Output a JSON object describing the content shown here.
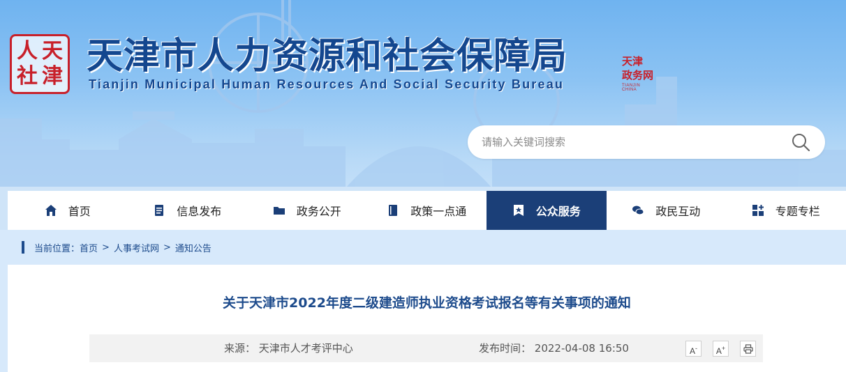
{
  "header": {
    "logo_text": [
      "人",
      "天",
      "社",
      "津"
    ],
    "title": "天津市人力资源和社会保障局",
    "subtitle": "Tianjin Municipal Human Resources And Social Security Bureau",
    "stamp_text": "天津 政务网",
    "stamp_sub": "TIANJIN CHINA"
  },
  "search": {
    "placeholder": "请输入关键词搜索"
  },
  "nav": {
    "items": [
      {
        "label": "首页",
        "icon": "home-icon",
        "active": false
      },
      {
        "label": "信息发布",
        "icon": "document-icon",
        "active": false
      },
      {
        "label": "政务公开",
        "icon": "folder-icon",
        "active": false
      },
      {
        "label": "政策一点通",
        "icon": "book-icon",
        "active": false
      },
      {
        "label": "公众服务",
        "icon": "star-badge-icon",
        "active": true
      },
      {
        "label": "政民互动",
        "icon": "chat-icon",
        "active": false
      },
      {
        "label": "专题专栏",
        "icon": "grid-plus-icon",
        "active": false
      }
    ]
  },
  "breadcrumb": {
    "prefix": "当前位置：",
    "items": [
      "首页",
      "人事考试网",
      "通知公告"
    ],
    "separator": ">"
  },
  "article": {
    "title": "关于天津市2022年度二级建造师执业资格考试报名等有关事项的通知",
    "source_label": "来源：",
    "source": "天津市人才考评中心",
    "time_label": "发布时间：",
    "time": "2022-04-08 16:50"
  },
  "tools": {
    "font_smaller": "A",
    "font_smaller_mark": "-",
    "font_larger": "A",
    "font_larger_mark": "+"
  },
  "colors": {
    "brand_blue": "#1b3f78",
    "title_blue": "#14478f",
    "seal_red": "#c8202a"
  }
}
